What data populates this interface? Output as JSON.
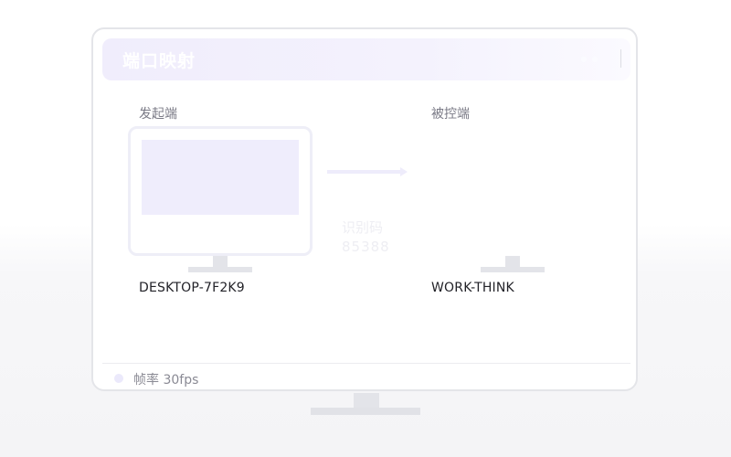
{
  "window": {
    "title": "端口映射"
  },
  "source": {
    "label": "发起端",
    "device_name": "DESKTOP-7F2K9"
  },
  "target": {
    "label": "被控端",
    "device_name": "WORK-THINK"
  },
  "connection": {
    "code_label": "识别码",
    "code_value": "85388"
  },
  "footer": {
    "fps_text": "帧率 30fps"
  },
  "colors": {
    "accent": "#efedfc",
    "frame": "#e4e5e9",
    "stand": "#e3e4e9"
  },
  "icons": {
    "arrow": "arrow-right-icon",
    "status": "status-dot-icon"
  }
}
